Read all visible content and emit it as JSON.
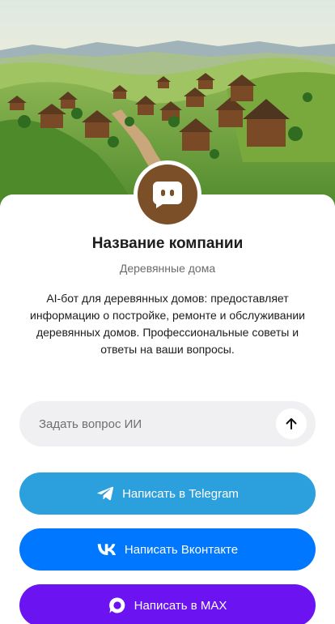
{
  "colors": {
    "telegram": "#2ca0dd",
    "vk": "#0077ff",
    "max": "#6b13f0",
    "avatar": "#7b4f28",
    "input_bg": "#f0f0f2"
  },
  "hero": {
    "icon": "village-landscape-image"
  },
  "company": {
    "avatar_icon": "chat-bot-icon",
    "name": "Название компании",
    "subtitle": "Деревянные дома",
    "description": "AI-бот для деревянных домов: предоставляет информацию о постройке, ремонте и обслуживании деревянных домов. Профессиональные советы и ответы на ваши вопросы."
  },
  "ask": {
    "placeholder": "Задать вопрос ИИ",
    "value": "",
    "send_icon": "arrow-up-icon"
  },
  "buttons": {
    "telegram": {
      "label": "Написать в Telegram",
      "icon": "telegram-icon"
    },
    "vk": {
      "label": "Написать Вконтакте",
      "icon": "vk-icon"
    },
    "max": {
      "label": "Написать в MAX",
      "icon": "max-icon"
    }
  }
}
